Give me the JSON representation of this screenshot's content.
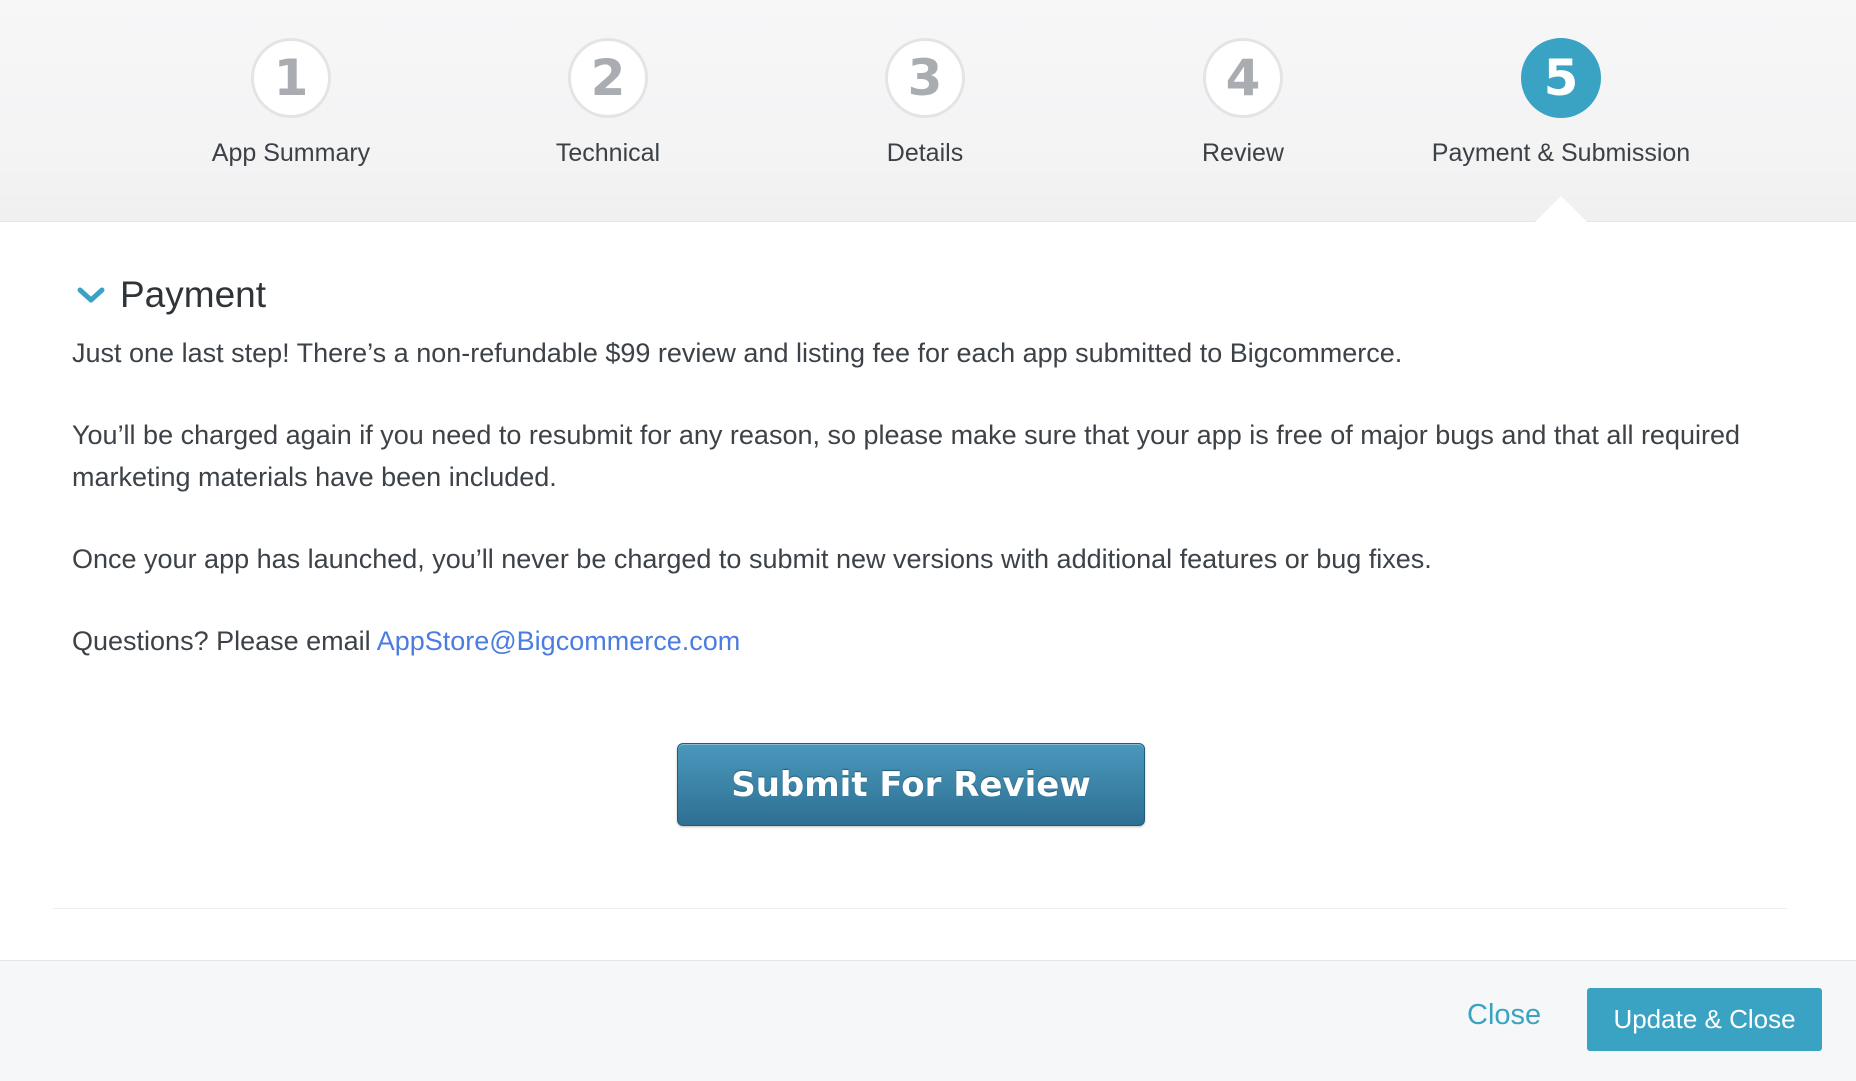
{
  "stepper": {
    "steps": [
      {
        "number": "1",
        "label": "App Summary"
      },
      {
        "number": "2",
        "label": "Technical"
      },
      {
        "number": "3",
        "label": "Details"
      },
      {
        "number": "4",
        "label": "Review"
      },
      {
        "number": "5",
        "label": "Payment & Submission"
      }
    ],
    "active_step": 5
  },
  "section": {
    "title": "Payment",
    "icon": "chevron-down-icon",
    "paragraphs": [
      "Just one last step! There’s a non-refundable $99 review and listing fee for each app submitted to Bigcommerce.",
      "You’ll be charged again if you need to resubmit for any reason, so please make sure that your app is free of major bugs and that all required marketing materials have been included.",
      "Once your app has launched, you’ll never be charged to submit new versions with additional features or bug fixes."
    ],
    "questions_prefix": "Questions? Please email ",
    "email": "AppStore@Bigcommerce.com"
  },
  "submit_button": {
    "label": "Submit For Review"
  },
  "footer": {
    "close_label": "Close",
    "update_label": "Update & Close"
  },
  "colors": {
    "accent": "#3aa3c4",
    "submit_button": "#3a82a6",
    "link": "#4b7de0",
    "inactive_step_number": "#a9adb1"
  }
}
